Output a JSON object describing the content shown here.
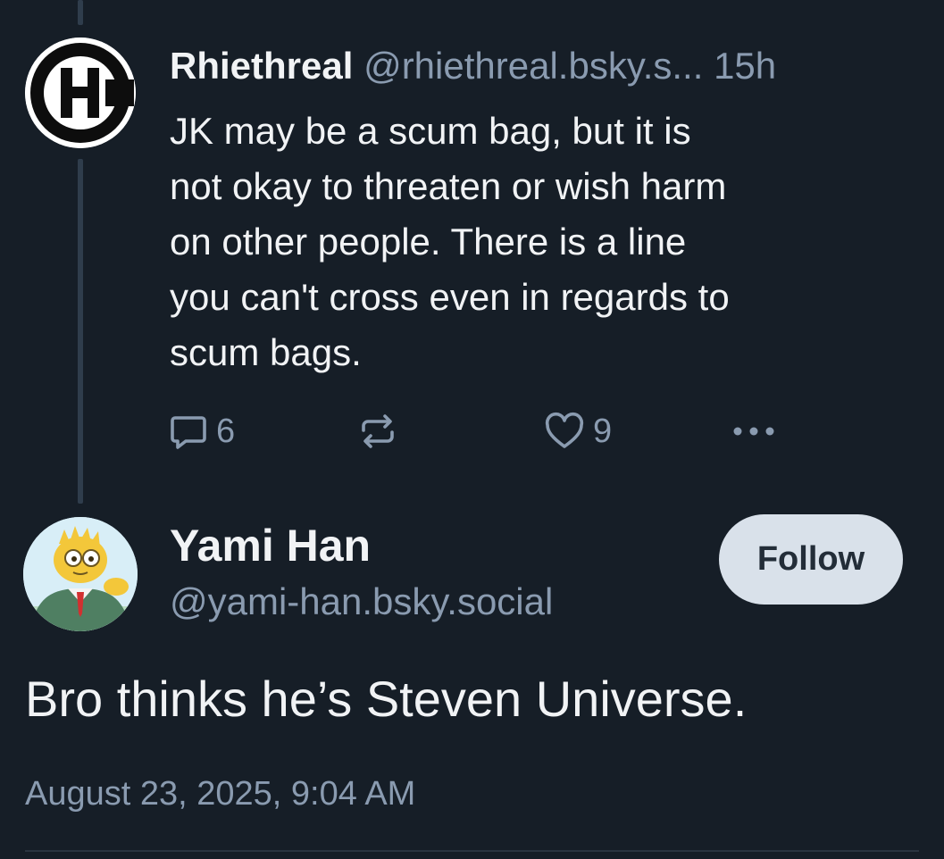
{
  "parent_post": {
    "display_name": "Rhiethreal",
    "handle": "@rhiethreal.bsky.s...",
    "time": "15h",
    "text": "JK may be a scum bag, but it is\nnot okay to threaten or wish harm\non other people. There is a line\nyou can't cross even in regards to\nscum bags.",
    "reply_count": "6",
    "like_count": "9",
    "icons": {
      "reply": "speech-bubble-icon",
      "repost": "repost-arrows-icon",
      "like": "heart-icon",
      "more": "ellipsis-icon"
    }
  },
  "main_post": {
    "display_name": "Yami Han",
    "handle": "@yami-han.bsky.social",
    "follow_label": "Follow",
    "text": "Bro thinks he’s Steven Universe.",
    "date": "August 23, 2025, 9:04 AM"
  },
  "colors": {
    "background": "#161e27",
    "primary_text": "#f1f3f5",
    "secondary_text": "#8a9bb0",
    "follow_button_bg": "#d9e1ea",
    "thread_line": "#2f3d4c"
  }
}
